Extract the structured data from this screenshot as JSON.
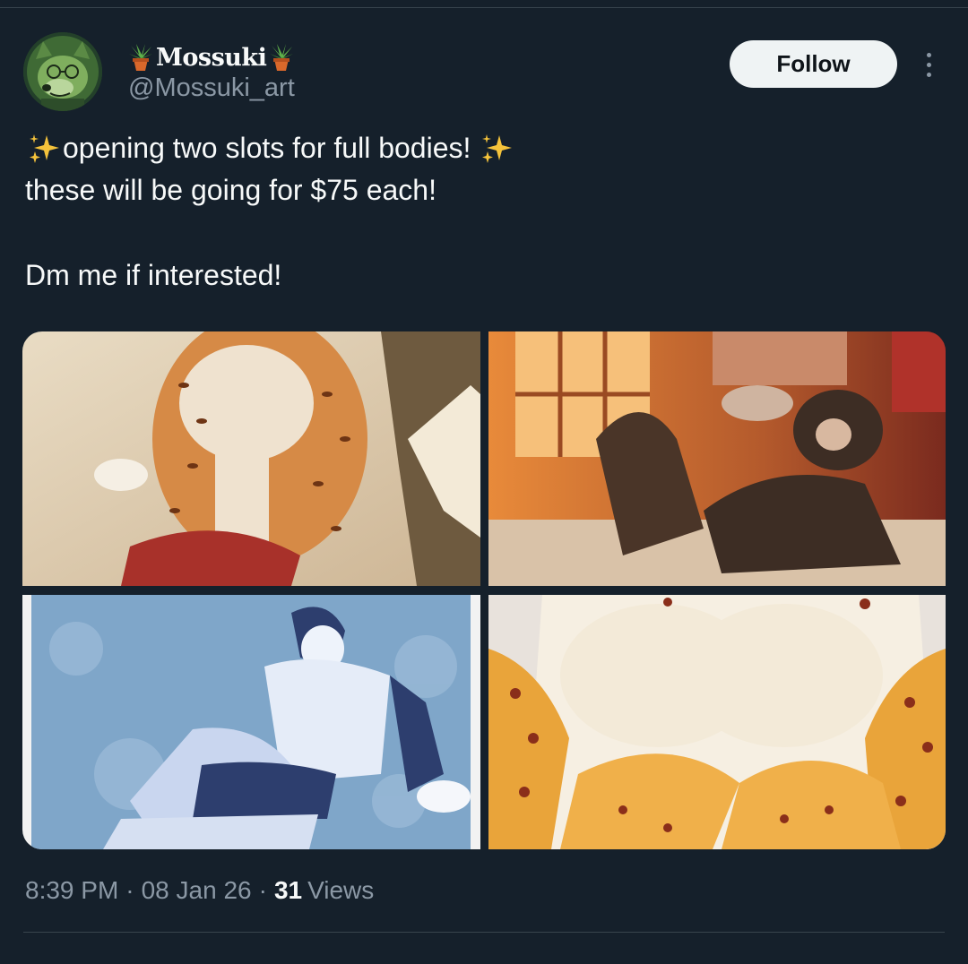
{
  "tweet": {
    "author": {
      "display_name": "Mossuki",
      "handle": "@Mossuki_art",
      "name_decoration_icon": "potted-plant-icon"
    },
    "follow_label": "Follow",
    "more_icon": "more-horizontal-icon",
    "text_lines": [
      "opening two slots for full bodies!",
      "these will be going for $75 each!",
      "",
      "Dm me if interested!"
    ],
    "emoji": "sparkles-icon",
    "media": [
      {
        "alt": "image 1",
        "palette": "warm-tan"
      },
      {
        "alt": "image 2",
        "palette": "sunset-orange"
      },
      {
        "alt": "image 3",
        "palette": "pale-blue"
      },
      {
        "alt": "image 4",
        "palette": "cream-orange"
      }
    ],
    "meta": {
      "time": "8:39 PM",
      "date": "08 Jan 26",
      "separator": "·",
      "views_count": "31",
      "views_label": "Views"
    }
  },
  "colors": {
    "background": "#15202b",
    "text_primary": "#f7f9f9",
    "text_secondary": "#8b98a5",
    "follow_bg": "#eff3f4",
    "divider": "#38444d"
  }
}
